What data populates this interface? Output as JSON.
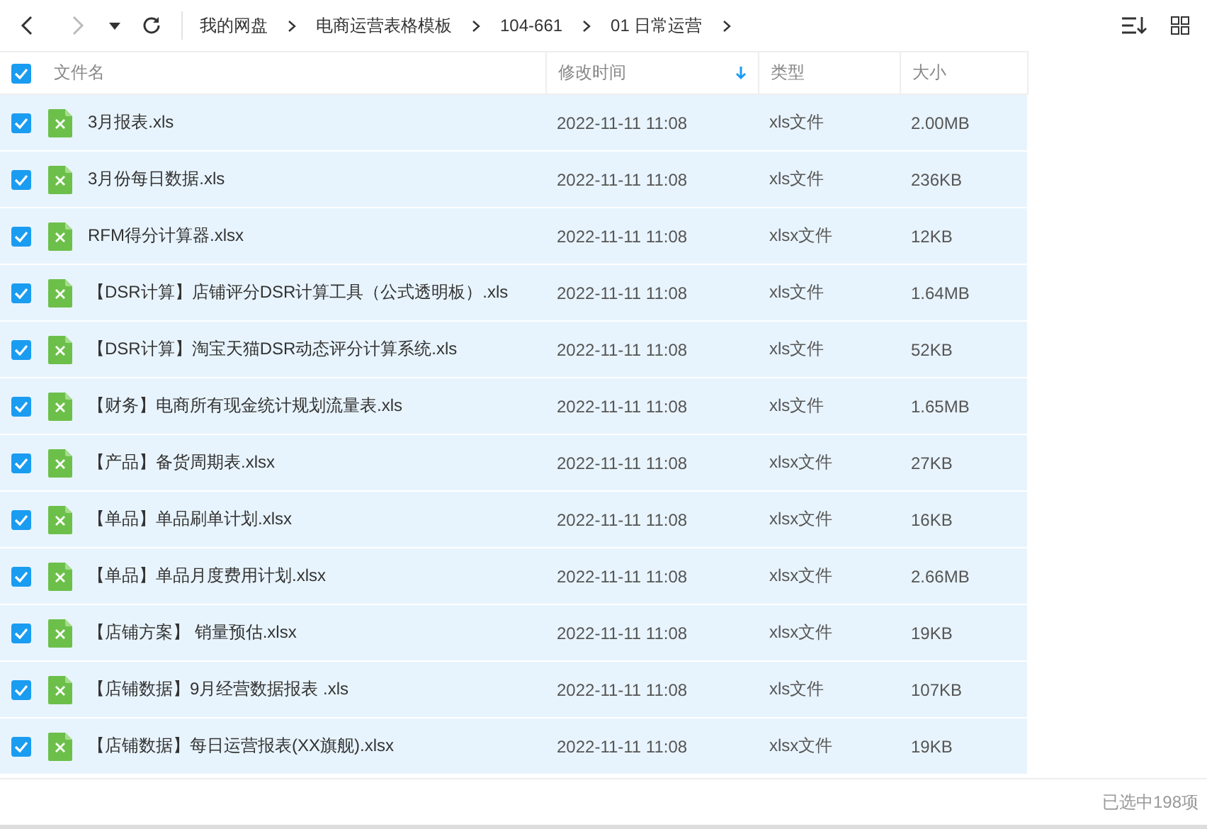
{
  "breadcrumb": [
    "我的网盘",
    "电商运营表格模板",
    "104-661",
    "01 日常运营"
  ],
  "header": {
    "all_checked": true,
    "columns": [
      {
        "label": "文件名",
        "sorted": false
      },
      {
        "label": "修改时间",
        "sorted": true
      },
      {
        "label": "类型",
        "sorted": false
      },
      {
        "label": "大小",
        "sorted": false
      }
    ]
  },
  "rows": [
    {
      "name": "3月报表.xls",
      "modified": "2022-11-11 11:08",
      "type": "xls文件",
      "size": "2.00MB",
      "selected": true
    },
    {
      "name": "3月份每日数据.xls",
      "modified": "2022-11-11 11:08",
      "type": "xls文件",
      "size": "236KB",
      "selected": true
    },
    {
      "name": "RFM得分计算器.xlsx",
      "modified": "2022-11-11 11:08",
      "type": "xlsx文件",
      "size": "12KB",
      "selected": true
    },
    {
      "name": "【DSR计算】店铺评分DSR计算工具（公式透明板）.xls",
      "modified": "2022-11-11 11:08",
      "type": "xls文件",
      "size": "1.64MB",
      "selected": true
    },
    {
      "name": "【DSR计算】淘宝天猫DSR动态评分计算系统.xls",
      "modified": "2022-11-11 11:08",
      "type": "xls文件",
      "size": "52KB",
      "selected": true
    },
    {
      "name": "【财务】电商所有现金统计规划流量表.xls",
      "modified": "2022-11-11 11:08",
      "type": "xls文件",
      "size": "1.65MB",
      "selected": true
    },
    {
      "name": "【产品】备货周期表.xlsx",
      "modified": "2022-11-11 11:08",
      "type": "xlsx文件",
      "size": "27KB",
      "selected": true
    },
    {
      "name": "【单品】单品刷单计划.xlsx",
      "modified": "2022-11-11 11:08",
      "type": "xlsx文件",
      "size": "16KB",
      "selected": true
    },
    {
      "name": "【单品】单品月度费用计划.xlsx",
      "modified": "2022-11-11 11:08",
      "type": "xlsx文件",
      "size": "2.66MB",
      "selected": true
    },
    {
      "name": "【店铺方案】 销量预估.xlsx",
      "modified": "2022-11-11 11:08",
      "type": "xlsx文件",
      "size": "19KB",
      "selected": true
    },
    {
      "name": "【店铺数据】9月经营数据报表 .xls",
      "modified": "2022-11-11 11:08",
      "type": "xls文件",
      "size": "107KB",
      "selected": true
    },
    {
      "name": "【店铺数据】每日运营报表(XX旗舰).xlsx",
      "modified": "2022-11-11 11:08",
      "type": "xlsx文件",
      "size": "19KB",
      "selected": true
    }
  ],
  "status": "已选中198项"
}
